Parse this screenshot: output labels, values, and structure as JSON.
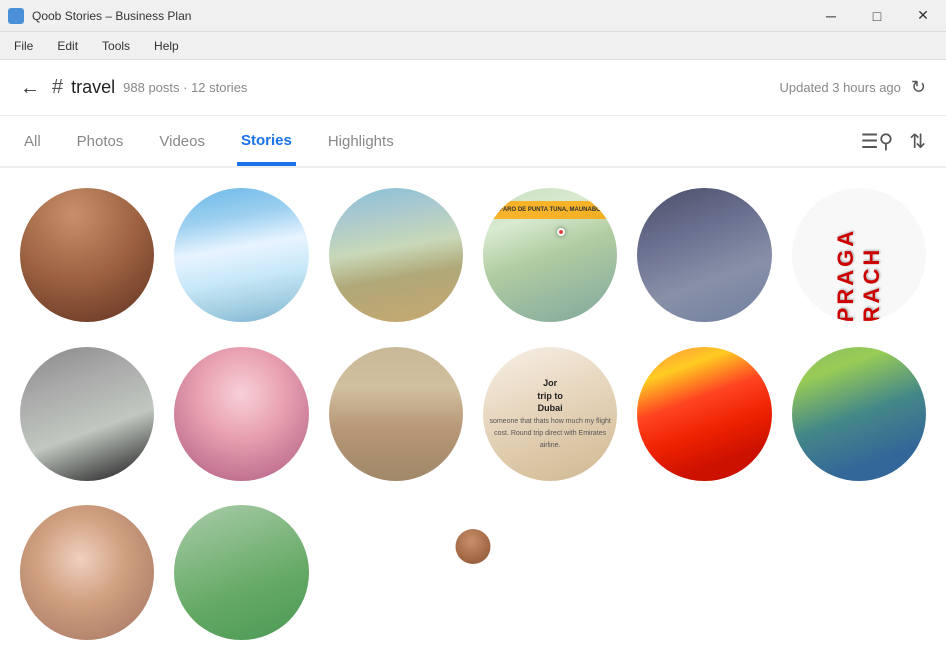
{
  "window": {
    "title": "Qoob Stories – Business Plan",
    "icon": "app-icon"
  },
  "titlebar": {
    "minimize_label": "─",
    "maximize_label": "□",
    "close_label": "✕"
  },
  "menubar": {
    "items": [
      {
        "label": "File"
      },
      {
        "label": "Edit"
      },
      {
        "label": "Tools"
      },
      {
        "label": "Help"
      }
    ]
  },
  "topnav": {
    "back_icon": "←",
    "hashtag_icon": "#",
    "tag_name": "travel",
    "tag_meta": "988 posts · 12 stories",
    "updated_text": "Updated 3 hours ago",
    "refresh_icon": "↻"
  },
  "tabs": {
    "items": [
      {
        "label": "All",
        "active": false
      },
      {
        "label": "Photos",
        "active": false
      },
      {
        "label": "Videos",
        "active": false
      },
      {
        "label": "Stories",
        "active": true
      },
      {
        "label": "Highlights",
        "active": false
      }
    ],
    "filter_icon": "☰",
    "sort_icon": "⇅"
  },
  "stories": {
    "items": [
      {
        "id": 1,
        "style": "person-face-dark"
      },
      {
        "id": 2,
        "style": "sky-clouds"
      },
      {
        "id": 3,
        "style": "beach-bench"
      },
      {
        "id": 4,
        "style": "map-location"
      },
      {
        "id": 5,
        "style": "person-jacket"
      },
      {
        "id": 6,
        "style": "rotated-text-praga"
      },
      {
        "id": 7,
        "style": "car-interior"
      },
      {
        "id": 8,
        "style": "person-pink"
      },
      {
        "id": 9,
        "style": "sandy-water"
      },
      {
        "id": 10,
        "style": "person-text-dubai"
      },
      {
        "id": 11,
        "style": "colorful-letters"
      },
      {
        "id": 12,
        "style": "green-landscape"
      },
      {
        "id": 13,
        "style": "couple-selfie"
      },
      {
        "id": 14,
        "style": "river-valley"
      }
    ]
  }
}
